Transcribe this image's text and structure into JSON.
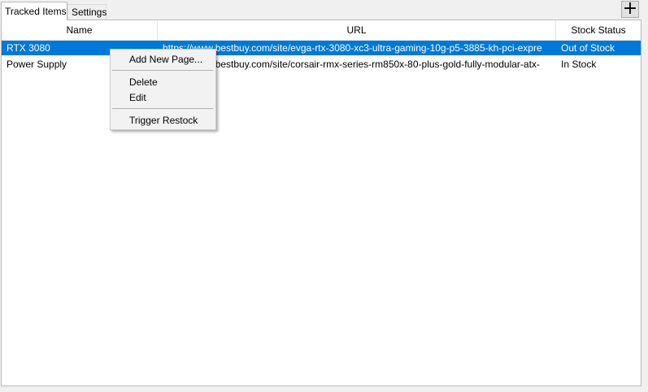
{
  "tabs": [
    {
      "label": "Tracked Items",
      "active": true
    },
    {
      "label": "Settings",
      "active": false
    }
  ],
  "toolbar": {
    "add_label": "+",
    "add_icon": "plus-icon"
  },
  "table": {
    "columns": [
      {
        "label": "Name"
      },
      {
        "label": "URL"
      },
      {
        "label": "Stock Status"
      }
    ],
    "rows": [
      {
        "name": "RTX 3080",
        "url": "https://www.bestbuy.com/site/evga-rtx-3080-xc3-ultra-gaming-10g-p5-3885-kh-pci-expre",
        "status": "Out of Stock",
        "selected": true
      },
      {
        "name": "Power Supply",
        "url": "https://www.bestbuy.com/site/corsair-rmx-series-rm850x-80-plus-gold-fully-modular-atx-",
        "status": "In Stock",
        "selected": false
      }
    ]
  },
  "context_menu": {
    "items": [
      {
        "label": "Add New Page..."
      },
      {
        "label": "Delete"
      },
      {
        "label": "Edit"
      },
      {
        "label": "Trigger Restock"
      }
    ]
  },
  "colors": {
    "selection": "#0078d7",
    "menu_background": "#f2f2f2"
  }
}
